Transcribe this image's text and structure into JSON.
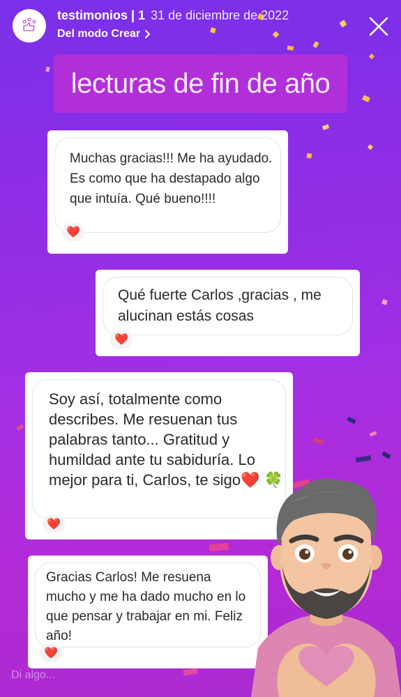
{
  "header": {
    "account_name": "testimonios | 1",
    "date": "31 de diciembre de 2022",
    "source_label": "Del modo Crear",
    "chevron_icon": "chevron-right-icon",
    "close_icon": "close-icon"
  },
  "title": "lecturas de fin de año",
  "messages": [
    {
      "text": "Muchas gracias!!! Me ha ayudado. Es como que ha destapado algo que intuía. Qué bueno!!!!",
      "reaction": "❤️"
    },
    {
      "text": "Qué fuerte Carlos ,gracias , me alucinan estás cosas",
      "reaction": "❤️"
    },
    {
      "text": "Soy así, totalmente como describes. Me resuenan tus palabras tanto... Gratitud y humildad ante tu sabiduría. Lo mejor para ti, Carlos, te sigo❤️ 🍀",
      "reaction": "❤️"
    },
    {
      "text": "Gracias Carlos! Me resuena mucho y me ha dado mucho en lo que pensar y trabajar en mi. Feliz año!",
      "reaction": "❤️"
    }
  ],
  "reply": {
    "placeholder": "Di algo..."
  },
  "colors": {
    "background_top": "#7a2fe8",
    "background_bottom": "#b42ad6",
    "title_banner": "#b12fd9",
    "heart": "#e0242c"
  }
}
